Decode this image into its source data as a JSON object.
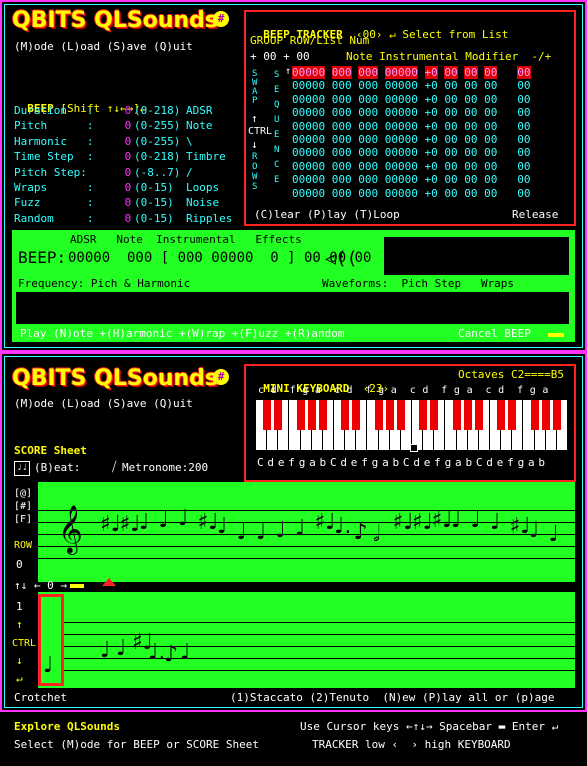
{
  "top": {
    "logo": "QBITS QLSounds",
    "menu": "(M)ode (L)oad (S)ave (Q)uit",
    "beep_title": "BEEP",
    "beep_shift": "[Shift ↑↓←→]↵",
    "params": [
      {
        "label": "Duration   :",
        "val": "0",
        "range": "(0-218)",
        "extra": "ADSR"
      },
      {
        "label": "Pitch      :",
        "val": "0",
        "range": "(0-255)",
        "extra": "Note"
      },
      {
        "label": "Harmonic   :",
        "val": "0",
        "range": "(0-255)",
        "extra": "\\"
      },
      {
        "label": "Time Step  :",
        "val": "0",
        "range": "(0-218)",
        "extra": "Timbre"
      },
      {
        "label": "Pitch Step:",
        "val": "0",
        "range": "(-8..7)",
        "extra": "/"
      },
      {
        "label": "Wraps      :",
        "val": "0",
        "range": "(0-15)",
        "extra": "Loops"
      },
      {
        "label": "Fuzz       :",
        "val": "0",
        "range": "(0-15)",
        "extra": "Noise"
      },
      {
        "label": "Random     :",
        "val": "0",
        "range": "(0-15)",
        "extra": "Ripples"
      }
    ],
    "tracker": {
      "title": "BEEP TRACKER",
      "num": "‹00›",
      "select": "↵ Select from List",
      "group_hdr": "GROUP ROW/List Num",
      "plus_row": "+ 00 + 00",
      "col_hdr": "Note Instrumental Modifier  -/+",
      "swap": "SWAP",
      "sequence": "SEQUENCE",
      "rows_lbl": "ROWS",
      "ctrl": "CTRL",
      "row_first": "00000 000 000 00000 +0 00 00 00   00",
      "row_normal": "00000 000 000 00000 +0 00 00 00   00",
      "row_count": 10,
      "footer_left": "(C)lear (P)lay (T)Loop",
      "footer_right": "Release"
    },
    "beep_bar": {
      "header": "ADSR   Note  Instrumental   Effects",
      "label": "BEEP:",
      "values": "00000  000 [ 000 00000  0 ] 00 00 00",
      "freq": "Frequency: Pich & Harmonic",
      "waves": "Waveforms:  Pich Step   Wraps",
      "footer": "Play (N)ote +(H)armonic +(W)rap +(F)uzz +(R)andom",
      "cancel": "Cancel BEEP"
    }
  },
  "bottom": {
    "logo": "QBITS QLSounds",
    "menu": "(M)ode (L)oad (S)ave (Q)uit",
    "score_title": "SCORE Sheet",
    "beat": "(B)eat:",
    "metronome": "Metronome:200",
    "keyboard": {
      "title": "MINI KEYBOARD",
      "num": "‹23›",
      "octaves": "Octaves C2====B5",
      "sharps": "c d  f g a  c d  f g a  c d  f g a  c d  f g a",
      "naturals": "CdefgabCdefgabCdefgabCdefgab"
    },
    "side_top": [
      "[@]",
      "[#]",
      "[F]"
    ],
    "row_lbl": "ROW",
    "row_val": "0",
    "ctrl_lbl": "CTRL",
    "one": "1",
    "crotchet": "Crotchet",
    "nav": "↑↓ ← 0 →",
    "footer": "(1)Staccato (2)Tenuto  (N)ew (P)lay all or (p)age"
  },
  "status": {
    "explore": "Explore QLSounds",
    "select": "Select (M)ode for BEEP or SCORE Sheet",
    "cursor": "Use Cursor keys ←↑↓→ Spacebar ▬ Enter ↵",
    "tracker": "TRACKER low ‹  › high KEYBOARD"
  }
}
